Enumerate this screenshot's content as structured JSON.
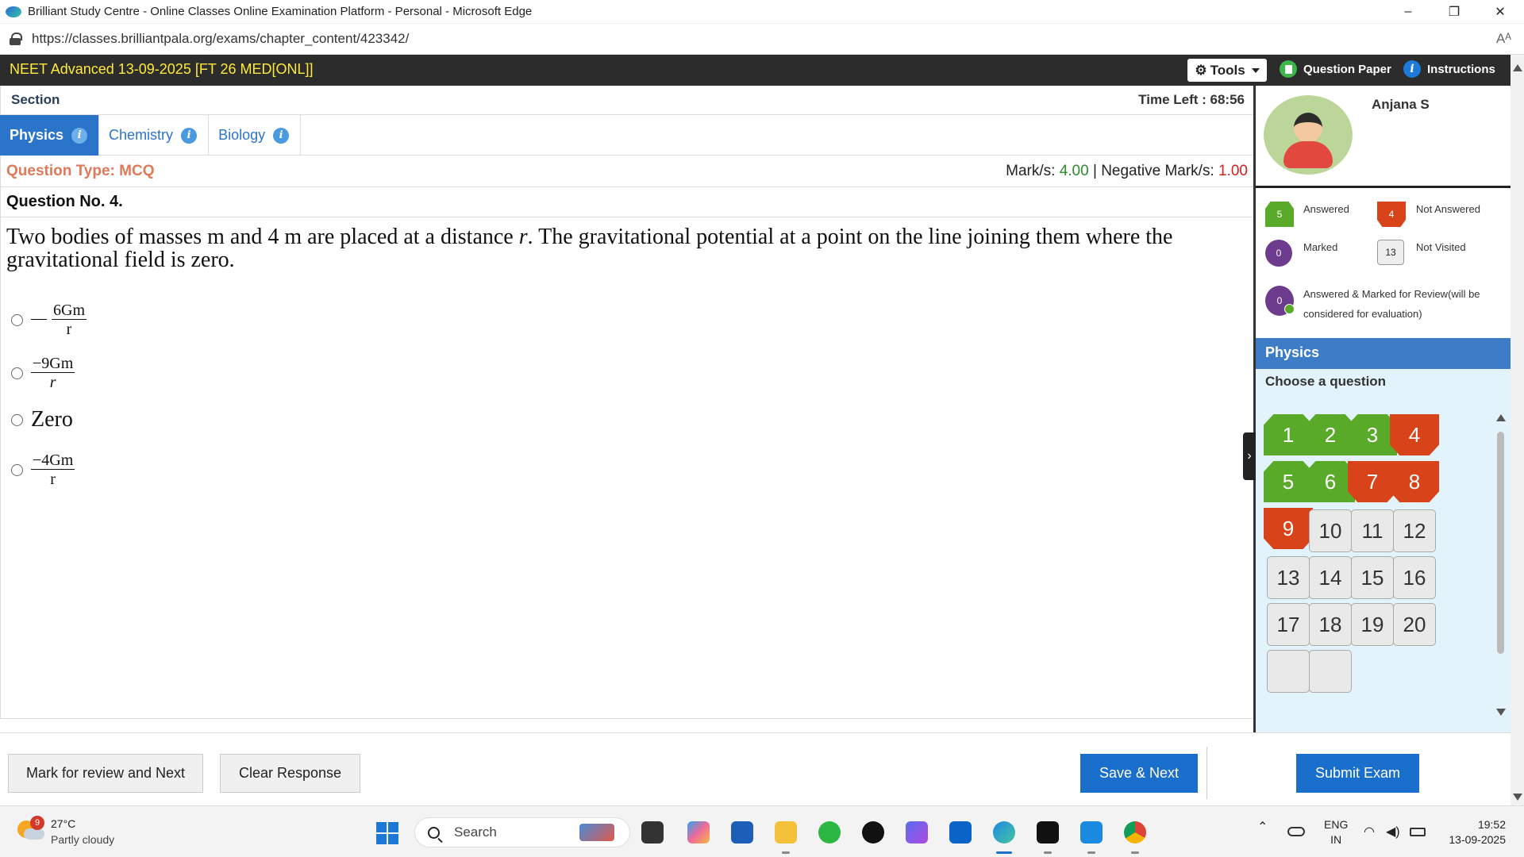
{
  "browser": {
    "window_title": "Brilliant Study Centre - Online Classes Online Examination Platform - Personal - Microsoft Edge",
    "url": "https://classes.brilliantpala.org/exams/chapter_content/423342/",
    "read_aloud": "Aᴬ",
    "min": "–",
    "max": "❐",
    "close": "✕"
  },
  "header": {
    "exam_title": "NEET Advanced 13-09-2025 [FT 26 MED[ONL]]",
    "tools_label": "Tools",
    "question_paper_label": "Question Paper",
    "instructions_label": "Instructions"
  },
  "section": {
    "label": "Section",
    "time_left": "Time Left : 68:56",
    "tabs": [
      {
        "label": "Physics",
        "active": true
      },
      {
        "label": "Chemistry",
        "active": false
      },
      {
        "label": "Biology",
        "active": false
      }
    ]
  },
  "question": {
    "type": "Question Type: MCQ",
    "marks_label": "Mark/s:",
    "marks_value": "4.00",
    "sep": "|",
    "neg_label": "Negative Mark/s:",
    "neg_value": "1.00",
    "number": "Question No. 4.",
    "text_a": "Two bodies of masses m and 4 m are placed at a distance ",
    "text_var": "r",
    "text_b": ". The gravitational potential at a point on the line joining them where the gravitational field is zero.",
    "options": [
      {
        "prefix": "—",
        "num": "6Gm",
        "den": "r"
      },
      {
        "prefix": "",
        "num": "−9Gm",
        "den": "r"
      },
      {
        "text": "Zero"
      },
      {
        "prefix": "",
        "num": "−4Gm",
        "den": "r"
      }
    ]
  },
  "profile": {
    "name": "Anjana S"
  },
  "legend": {
    "answered_count": "5",
    "answered_label": "Answered",
    "not_answered_count": "4",
    "not_answered_label": "Not Answered",
    "marked_count": "0",
    "marked_label": "Marked",
    "not_visited_count": "13",
    "not_visited_label": "Not Visited",
    "ans_marked_count": "0",
    "ans_marked_label_1": "Answered & Marked for Review(will be",
    "ans_marked_label_2": "considered for evaluation)"
  },
  "palette": {
    "subject": "Physics",
    "choose_label": "Choose a question",
    "questions": [
      {
        "n": "1",
        "s": "ans"
      },
      {
        "n": "2",
        "s": "ans"
      },
      {
        "n": "3",
        "s": "ans"
      },
      {
        "n": "4",
        "s": "not"
      },
      {
        "n": "5",
        "s": "ans"
      },
      {
        "n": "6",
        "s": "ans"
      },
      {
        "n": "7",
        "s": "not"
      },
      {
        "n": "8",
        "s": "not"
      },
      {
        "n": "9",
        "s": "not"
      },
      {
        "n": "10",
        "s": "nv"
      },
      {
        "n": "11",
        "s": "nv"
      },
      {
        "n": "12",
        "s": "nv"
      },
      {
        "n": "13",
        "s": "nv"
      },
      {
        "n": "14",
        "s": "nv"
      },
      {
        "n": "15",
        "s": "nv"
      },
      {
        "n": "16",
        "s": "nv"
      },
      {
        "n": "17",
        "s": "nv"
      },
      {
        "n": "18",
        "s": "nv"
      },
      {
        "n": "19",
        "s": "nv"
      },
      {
        "n": "20",
        "s": "nv"
      },
      {
        "n": "",
        "s": "nv"
      },
      {
        "n": "",
        "s": "nv"
      }
    ]
  },
  "actions": {
    "mark_review": "Mark for review and Next",
    "clear": "Clear Response",
    "save_next": "Save & Next",
    "submit": "Submit Exam"
  },
  "taskbar": {
    "weather_badge": "9",
    "temp": "27°C",
    "condition": "Partly cloudy",
    "search": "Search",
    "lang_1": "ENG",
    "lang_2": "IN",
    "time": "19:52",
    "date": "13-09-2025"
  },
  "colors": {
    "answered": "#5aaa2a",
    "not_answered": "#d8431a",
    "marked": "#6e3c8e",
    "accent": "#1b6fcc",
    "exam_title": "#ffe93d"
  }
}
